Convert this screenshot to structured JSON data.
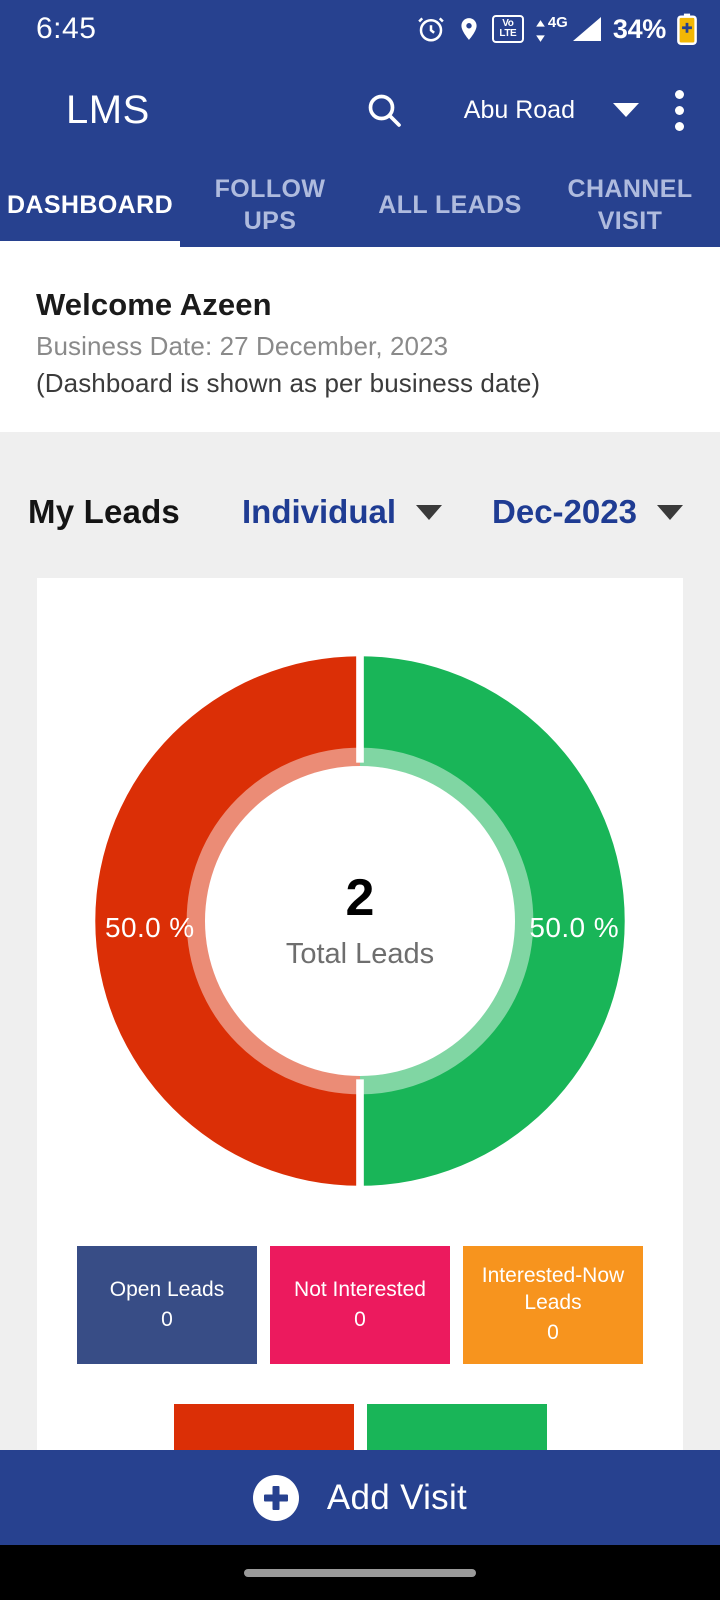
{
  "status_bar": {
    "clock": "6:45",
    "battery_text": "34%",
    "network": "4G",
    "volte_top": "Vo",
    "volte_bottom": "LTE",
    "icons": [
      "alarm-icon",
      "location-icon",
      "volte-icon",
      "signal-icon",
      "battery-icon"
    ]
  },
  "app_bar": {
    "title": "LMS",
    "search_icon": "search-icon",
    "location": "Abu Road",
    "overflow_icon": "more-vertical-icon"
  },
  "tabs": [
    {
      "label": "DASHBOARD",
      "active": true
    },
    {
      "label": "FOLLOW UPS",
      "active": false
    },
    {
      "label": "ALL LEADS",
      "active": false
    },
    {
      "label": "CHANNEL VISIT",
      "active": false
    }
  ],
  "welcome": {
    "title": "Welcome Azeen",
    "business_date": "Business Date: 27 December, 2023",
    "note": "(Dashboard is shown as per business date)"
  },
  "filter_bar": {
    "title": "My Leads",
    "type_value": "Individual",
    "period_value": "Dec-2023"
  },
  "chart_data": {
    "type": "pie",
    "title": "My Leads",
    "subtitle": "Total Leads",
    "center_value": "2",
    "center_label": "Total Leads",
    "total": 2,
    "donut": true,
    "legend_position": "bottom",
    "slices": [
      {
        "label": "Not Interested",
        "value": 1,
        "percent": 50.0,
        "percent_label": "50.0 %",
        "color": "#DB2F06"
      },
      {
        "label": "Interested-Now Leads",
        "value": 1,
        "percent": 50.0,
        "percent_label": "50.0 %",
        "color": "#19B558"
      }
    ]
  },
  "legend_cards": [
    {
      "label": "Open Leads",
      "value": "0",
      "color": "#384D86"
    },
    {
      "label": "Not Interested",
      "value": "0",
      "color": "#EC1A5E"
    },
    {
      "label": "Interested-Now Leads",
      "value": "0",
      "color": "#F7941E"
    }
  ],
  "legend_cards_row2": [
    {
      "label": "",
      "value": "",
      "color": "#DB2F06"
    },
    {
      "label": "",
      "value": "",
      "color": "#19B558"
    }
  ],
  "bottom_bar": {
    "label": "Add Visit",
    "icon": "plus-circle-icon"
  },
  "colors": {
    "brand_blue": "#27418F",
    "accent_link": "#1F3C93",
    "page_bg": "#EFEFEF",
    "red": "#DB2F06",
    "green": "#19B558"
  }
}
